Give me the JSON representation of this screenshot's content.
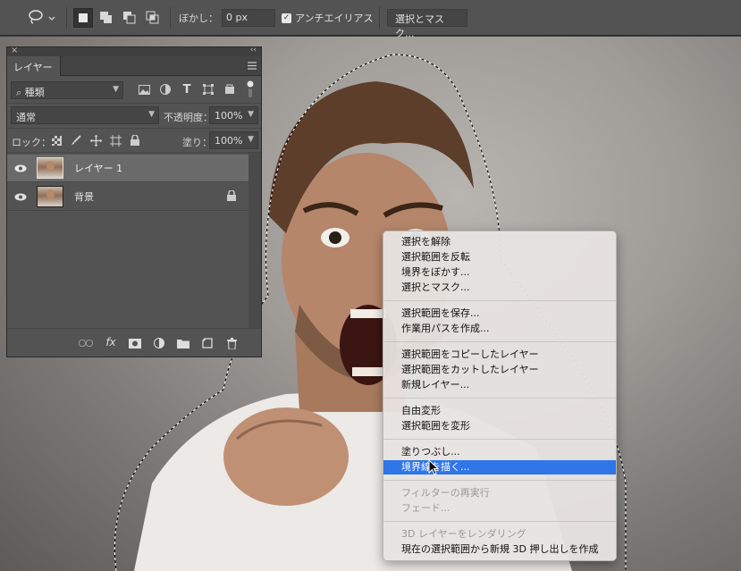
{
  "options_bar": {
    "feather_label": "ぼかし：",
    "feather_value": "0 px",
    "antialias_checked": true,
    "antialias_label": "アンチエイリアス",
    "select_mask_button": "選択とマスク..."
  },
  "layers_panel": {
    "tab_label": "レイヤー",
    "filter_kind": "種類",
    "blend_mode": "通常",
    "opacity_label": "不透明度：",
    "opacity_value": "100%",
    "lock_label": "ロック：",
    "fill_label": "塗り：",
    "fill_value": "100%",
    "layers": [
      {
        "name": "レイヤー 1",
        "selected": true,
        "locked": false
      },
      {
        "name": "背景",
        "selected": false,
        "locked": true
      }
    ],
    "footer_fx": "fx"
  },
  "context_menu": {
    "groups": [
      [
        "選択を解除",
        "選択範囲を反転",
        "境界をぼかす...",
        "選択とマスク..."
      ],
      [
        "選択範囲を保存...",
        "作業用パスを作成..."
      ],
      [
        "選択範囲をコピーしたレイヤー",
        "選択範囲をカットしたレイヤー",
        "新規レイヤー..."
      ],
      [
        "自由変形",
        "選択範囲を変形"
      ],
      [
        "塗りつぶし...",
        "境界線を描く..."
      ],
      [
        "フィルターの再実行",
        "フェード..."
      ],
      [
        "3D レイヤーをレンダリング",
        "現在の選択範囲から新規 3D 押し出しを作成"
      ]
    ],
    "highlighted": "境界線を描く...",
    "disabled": [
      "フィルターの再実行",
      "フェード...",
      "3D レイヤーをレンダリング"
    ]
  }
}
